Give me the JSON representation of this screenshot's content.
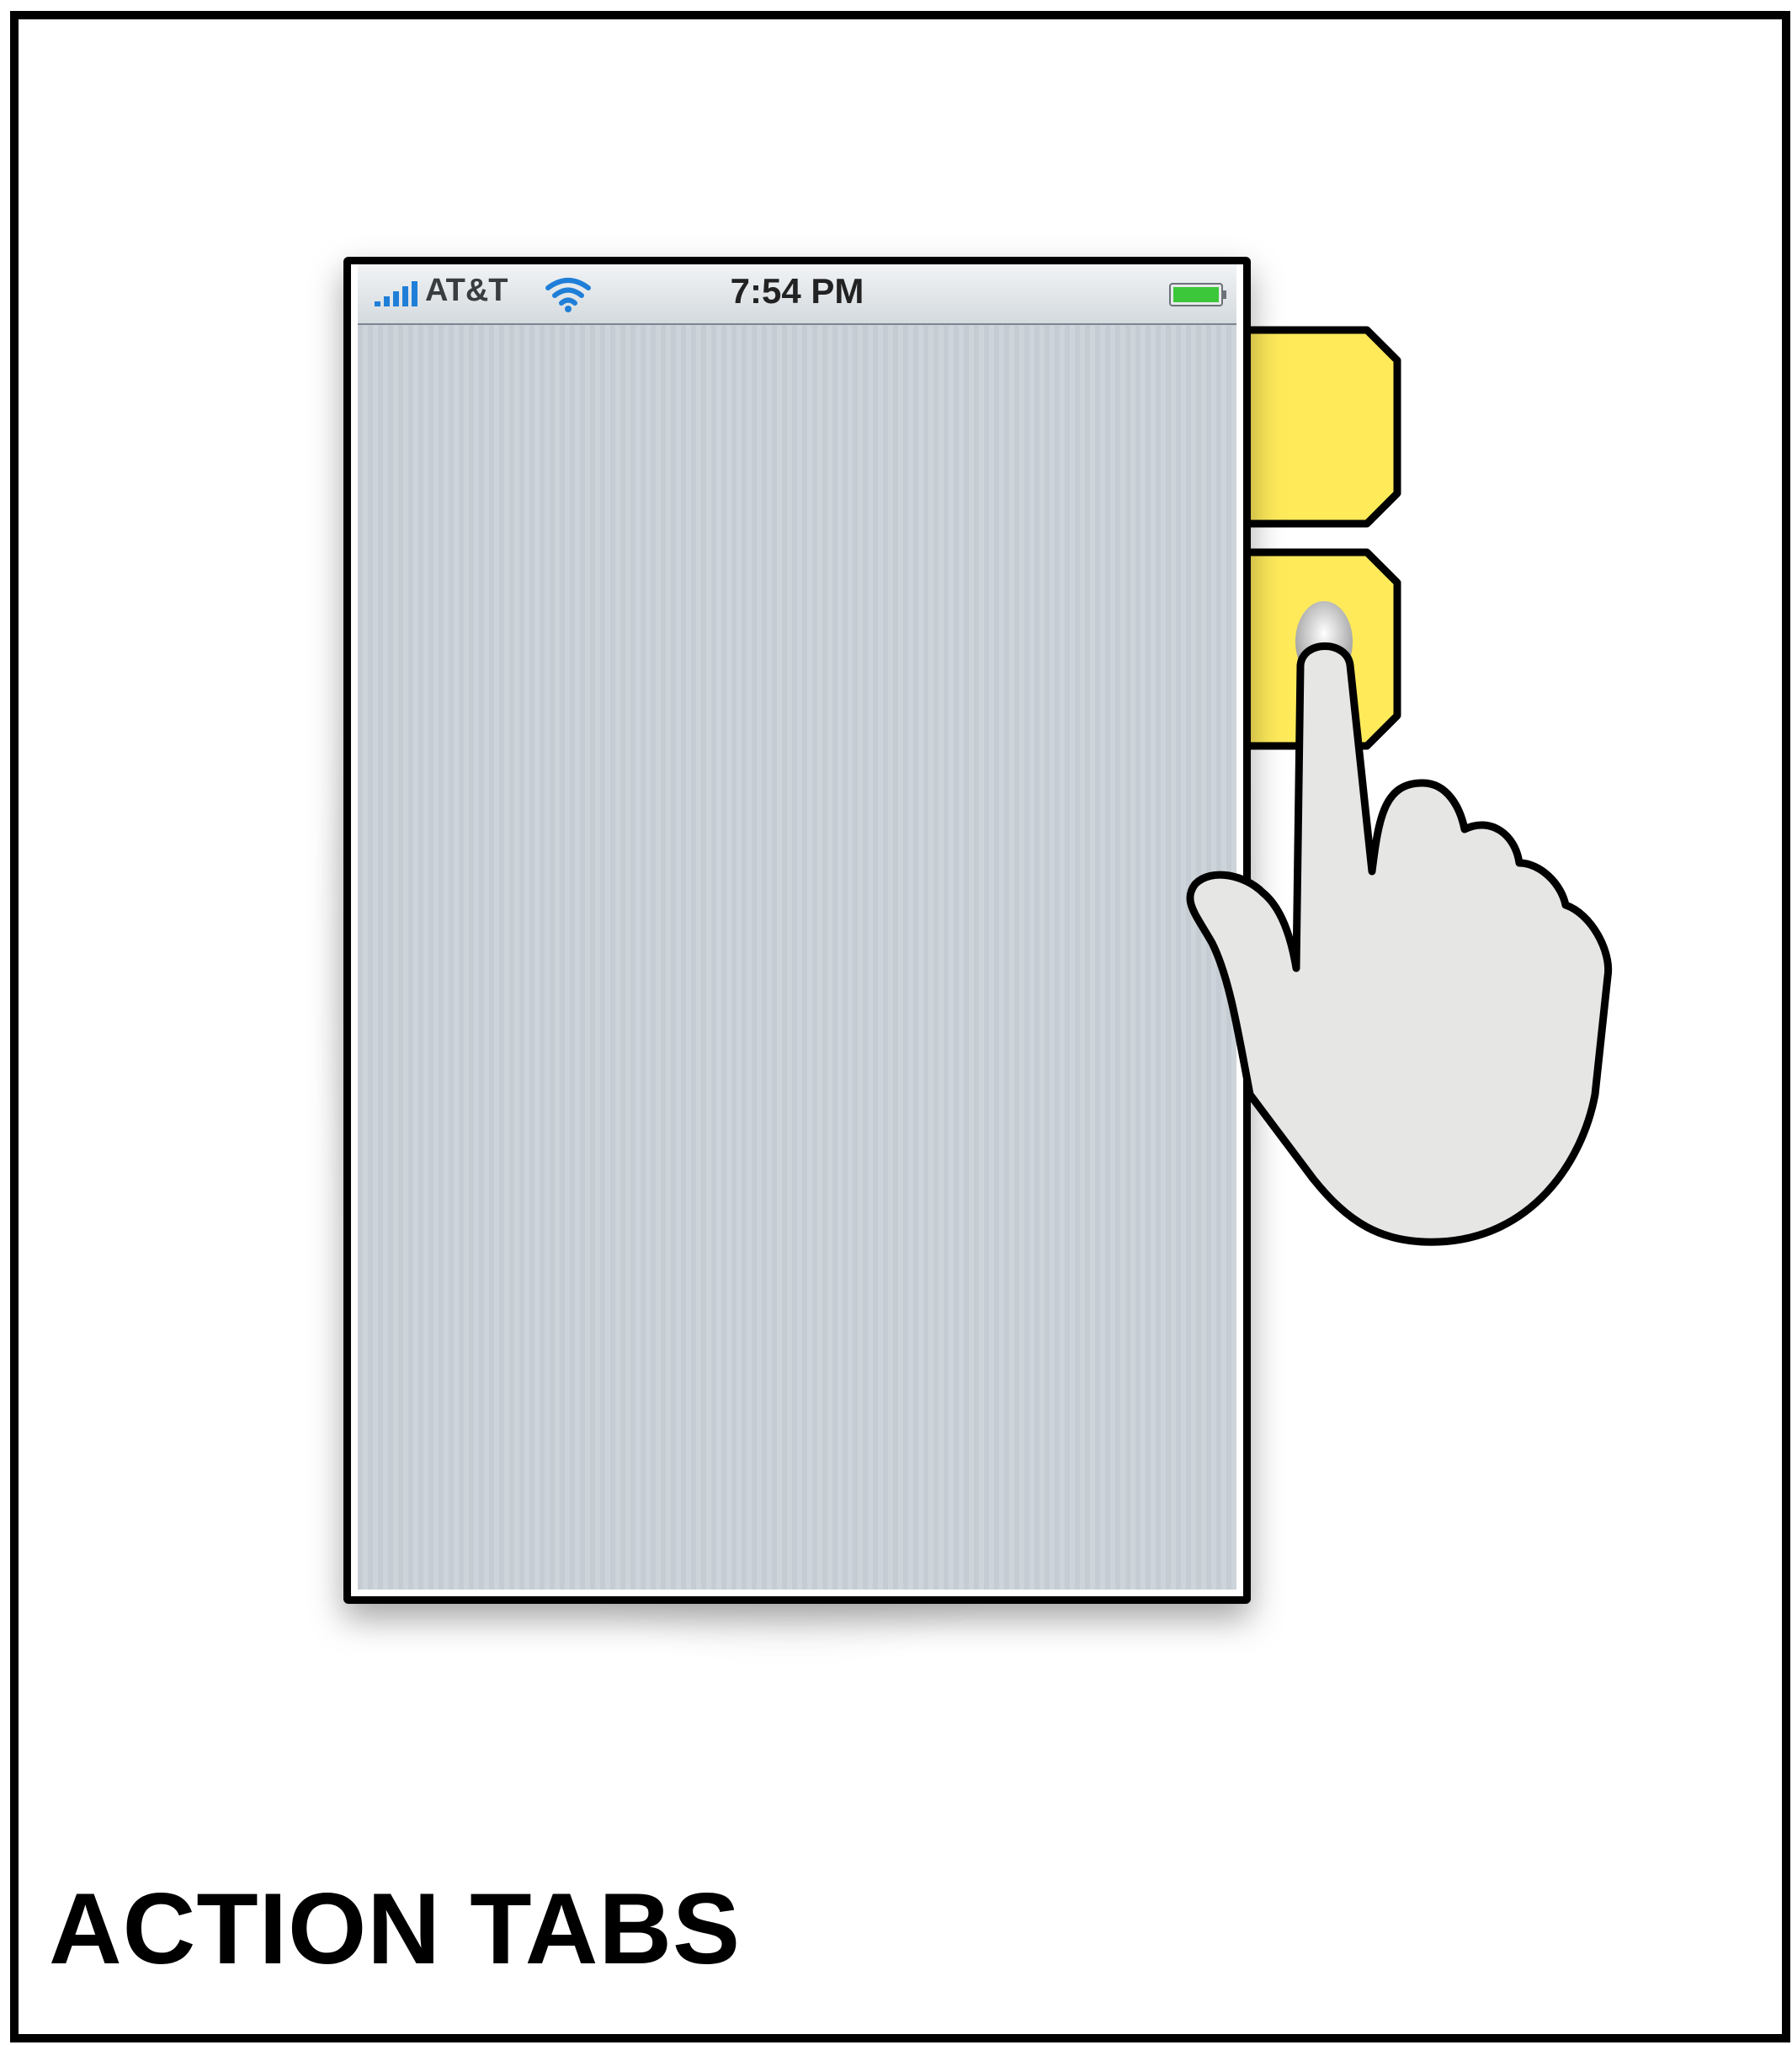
{
  "status_bar": {
    "carrier": "AT&T",
    "time": "7:54 PM",
    "icons": [
      "signal-icon",
      "wifi-icon",
      "battery-icon"
    ]
  },
  "tabs": [
    {
      "name": "action-tab-1",
      "color": "#ffeb5a"
    },
    {
      "name": "action-tab-2",
      "color": "#ffeb5a",
      "pressed": true
    }
  ],
  "pointer": {
    "icon": "hand-pointer-icon",
    "fill": "#e6e6e4"
  },
  "caption": "ACTION TABS"
}
